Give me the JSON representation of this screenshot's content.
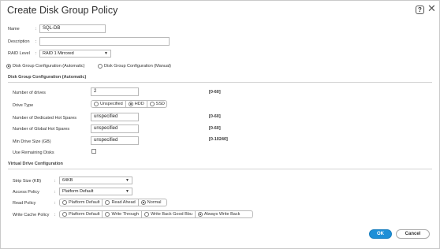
{
  "dialog": {
    "title": "Create Disk Group Policy",
    "help_symbol": "?",
    "close_symbol": "✕"
  },
  "form": {
    "name_label": "Name",
    "name_value": "SQL-DB",
    "description_label": "Description",
    "description_value": "",
    "raid_label": "RAID Level",
    "raid_value": "RAID 1 Mirrored",
    "separator": ":"
  },
  "config_mode": {
    "automatic_label": "Disk Group Configuration (Automatic)",
    "manual_label": "Disk Group Configuration (Manual)",
    "selected": "automatic"
  },
  "auto_section": {
    "title": "Disk Group Configuration (Automatic)",
    "num_drives_label": "Number of drives",
    "num_drives_value": "2",
    "num_drives_range": "[0-60]",
    "drive_type_label": "Drive Type",
    "drive_type_options": [
      "Unspecified",
      "HDD",
      "SSD"
    ],
    "drive_type_selected": "HDD",
    "dedicated_spares_label": "Number of Dedicated Hot Spares",
    "dedicated_spares_value": "unspecified",
    "dedicated_spares_range": "[0-60]",
    "global_spares_label": "Number of Global Hot Spares",
    "global_spares_value": "unspecified",
    "global_spares_range": "[0-60]",
    "min_drive_label": "Min Drive Size (GB)",
    "min_drive_value": "unspecified",
    "min_drive_range": "[0-10240]",
    "use_remaining_label": "Use Remaining Disks",
    "use_remaining_checked": false
  },
  "virtual_section": {
    "title": "Virtual Drive Configuration",
    "strip_size_label": "Strip Size (KB)",
    "strip_size_value": "64KB",
    "access_policy_label": "Access Policy",
    "access_policy_value": "Platform Default",
    "read_policy_label": "Read Policy",
    "read_policy_options": [
      "Platform Default",
      "Read Ahead",
      "Normal"
    ],
    "read_policy_selected": "Normal",
    "write_cache_label": "Write Cache Policy",
    "write_cache_options": [
      "Platform Default",
      "Write Through",
      "Write Back Good Bbu",
      "Always Write Back"
    ],
    "write_cache_selected": "Always Write Back"
  },
  "buttons": {
    "ok": "OK",
    "cancel": "Cancel"
  },
  "colors": {
    "primary": "#1d8fd7"
  }
}
